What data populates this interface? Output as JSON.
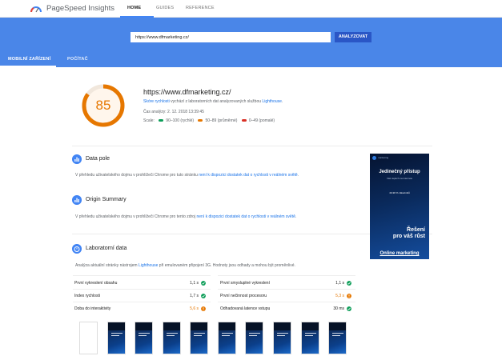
{
  "header": {
    "brand": "PageSpeed Insights",
    "nav": [
      "HOME",
      "GUIDES",
      "REFERENCE"
    ]
  },
  "hero": {
    "url_value": "https://www.dfmarketing.cz/",
    "analyze_label": "ANALYZOVAT",
    "device_tabs": [
      "MOBILNÍ ZAŘÍZENÍ",
      "POČÍTAČ"
    ]
  },
  "score": {
    "value": "85",
    "fraction": 0.85,
    "color": "#e67700",
    "url": "https://www.dfmarketing.cz/",
    "summary_prefix": "Skóre rychlosti",
    "summary_middle": " vychází z laboratorních dat analyzovaných službou ",
    "summary_link": "Lighthouse",
    "summary_suffix": ".",
    "analysis_time": "Čas analýzy: 2. 12. 2018 13:39:45",
    "scale_label": "Scale:",
    "scale_fast": "90–100 (rychlé)",
    "scale_average": "50–89 (průměrné)",
    "scale_slow": "0–49 (pomalé)",
    "colors": {
      "fast": "#0c9d58",
      "average": "#e67700",
      "slow": "#d93025"
    }
  },
  "field_data": {
    "title": "Data pole",
    "text_prefix": "V přehledu uživatelského dojmu v prohlížeči Chrome pro tuto stránku ",
    "text_link": "není k dispozici dostatek dat o rychlosti v reálném světě",
    "text_suffix": "."
  },
  "origin_summary": {
    "title": "Origin Summary",
    "text_prefix": "V přehledu uživatelského dojmu v prohlížeči Chrome pro tento zdroj ",
    "text_link": "není k dispozici dostatek dat o rychlosti v reálném světě",
    "text_suffix": "."
  },
  "lab_data": {
    "title": "Laboratorní data",
    "text_prefix": "Analýza aktuální stránky nástrojem ",
    "text_link": "Lighthouse",
    "text_suffix": " při emulovaném připojení 3G. Hodnoty jsou odhady a mohou být proměnlivé.",
    "metrics_left": [
      {
        "label": "První vykreslení obsahu",
        "value": "1,1 s",
        "status": "fast"
      },
      {
        "label": "Index rychlosti",
        "value": "1,7 s",
        "status": "fast"
      },
      {
        "label": "Doba do interaktivity",
        "value": "5,6 s",
        "status": "average"
      }
    ],
    "metrics_right": [
      {
        "label": "První smysluplné vykreslení",
        "value": "1,1 s",
        "status": "fast"
      },
      {
        "label": "První nečinnost procesoru",
        "value": "5,3 s",
        "status": "average"
      },
      {
        "label": "Odhadovaná latence vstupu",
        "value": "30 ms",
        "status": "fast"
      }
    ]
  },
  "ad": {
    "brand": "marketing",
    "headline": "Jedinečný přístup",
    "sub": "Váš úspěch na internetu",
    "stat": "40-90 % zákazníků",
    "cta_line1": "Řešení",
    "cta_line2": "pro váš růst",
    "footer": "Online marketing"
  }
}
